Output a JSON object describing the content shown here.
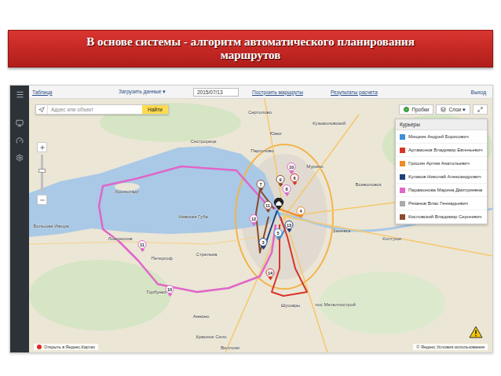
{
  "slide": {
    "title_lines": [
      "В основе системы - алгоритм автоматического планирования",
      "маршрутов"
    ]
  },
  "toolbar": {
    "items": [
      {
        "label": "Таблица",
        "kind": "link"
      },
      {
        "label": "Загрузить данные ▾",
        "kind": "menu"
      },
      {
        "label": "2015/07/13",
        "kind": "date"
      },
      {
        "label": "Построить маршруты",
        "kind": "link"
      },
      {
        "label": "Результаты расчета",
        "kind": "link"
      }
    ],
    "logout": "Выход"
  },
  "map": {
    "search": {
      "placeholder": "Адрес или объект",
      "button": "Найти"
    },
    "controls": [
      {
        "label": "Пробки",
        "kind": "traffic"
      },
      {
        "label": "Слои ▾",
        "kind": "layers"
      }
    ],
    "places": [
      {
        "name": "Сертолово"
      },
      {
        "name": "Юкки"
      },
      {
        "name": "Кузьмоловский"
      },
      {
        "name": "Сестрорецк"
      },
      {
        "name": "Парголово"
      },
      {
        "name": "Мурино"
      },
      {
        "name": "Всеволожск"
      },
      {
        "name": "Кронштадт"
      },
      {
        "name": "Невская Губа"
      },
      {
        "name": "Большая Ижора"
      },
      {
        "name": "Ломоносов"
      },
      {
        "name": "Петергоф"
      },
      {
        "name": "Стрельна"
      },
      {
        "name": "Заневка"
      },
      {
        "name": "Колтуши"
      },
      {
        "name": "Горбунки"
      },
      {
        "name": "Шушары"
      },
      {
        "name": "пос Металлострой"
      },
      {
        "name": "Аннино"
      },
      {
        "name": "Красное Село"
      },
      {
        "name": "Виллози"
      }
    ],
    "markers": [
      {
        "label": "10",
        "color": "#e066c9"
      },
      {
        "label": "9",
        "color": "#8b4a2b"
      },
      {
        "label": "8",
        "color": "#e066c9"
      },
      {
        "label": "7",
        "color": "#8b4a2b"
      },
      {
        "label": "6",
        "color": "#d9342b"
      },
      {
        "label": "11",
        "color": "#8b4a2b"
      },
      {
        "label": "12",
        "color": "#e066c9"
      },
      {
        "label": "13",
        "color": "#1e3f7a"
      },
      {
        "label": "5",
        "color": "#3d8fd6"
      },
      {
        "label": "11",
        "color": "#e066c9"
      },
      {
        "label": "14",
        "color": "#d9342b"
      },
      {
        "label": "10",
        "color": "#e066c9"
      },
      {
        "label": "4",
        "color": "#f08a24"
      },
      {
        "label": "3",
        "color": "#1e3f7a"
      }
    ]
  },
  "couriers": {
    "title": "Курьеры",
    "items": [
      {
        "name": "Мищкин Андрей Борисович",
        "color": "#3d8fd6"
      },
      {
        "name": "Артамонов Владимир Евгеньевич",
        "color": "#d9342b"
      },
      {
        "name": "Гришин Артем Анатольевич",
        "color": "#f08a24"
      },
      {
        "name": "Кулаков Николай Александрович",
        "color": "#1e3f7a"
      },
      {
        "name": "Парамонова Марина Дмитриевна",
        "color": "#e066c9"
      },
      {
        "name": "Рязанов Влас Геннадьевич",
        "color": "#aaaaaa"
      },
      {
        "name": "Кисловский Владимир Сергеевич",
        "color": "#8b4a2b"
      }
    ]
  },
  "footer": {
    "open": "Открыть в Яндекс.Картах",
    "attribution": "© Яндекс Условия использования"
  }
}
